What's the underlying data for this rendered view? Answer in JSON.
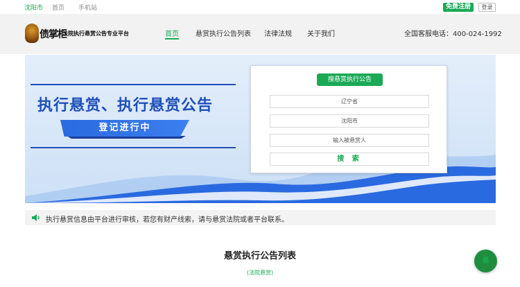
{
  "topbar": {
    "city": "沈阳市",
    "home": "首页",
    "mobile": "手机站",
    "register": "免费注册",
    "login": "登录"
  },
  "header": {
    "brand": "债掌柜",
    "slogan": "法院执行悬赏公告专业平台",
    "nav": [
      "首页",
      "悬赏执行公告列表",
      "法律法规",
      "关于我们"
    ],
    "hotline": "全国客服电话：400-024-1992"
  },
  "banner": {
    "headline": "执行悬赏、执行悬赏公告",
    "ribbon": "登记进行中"
  },
  "search_card": {
    "title": "搜悬赏执行公告",
    "province": "辽宁省",
    "city": "沈阳市",
    "name_placeholder": "输入被悬赏人",
    "button": "搜 索"
  },
  "notice": {
    "text": "执行悬赏信息由平台进行审核，若您有财产线索，请与悬赏法院或者平台联系。"
  },
  "section": {
    "title": "悬赏执行公告列表",
    "subtitle": "(法院悬赏)"
  },
  "float_button": {
    "label": "悬"
  },
  "colors": {
    "accent": "#1aaa55",
    "banner_blue": "#1f4fb8"
  }
}
